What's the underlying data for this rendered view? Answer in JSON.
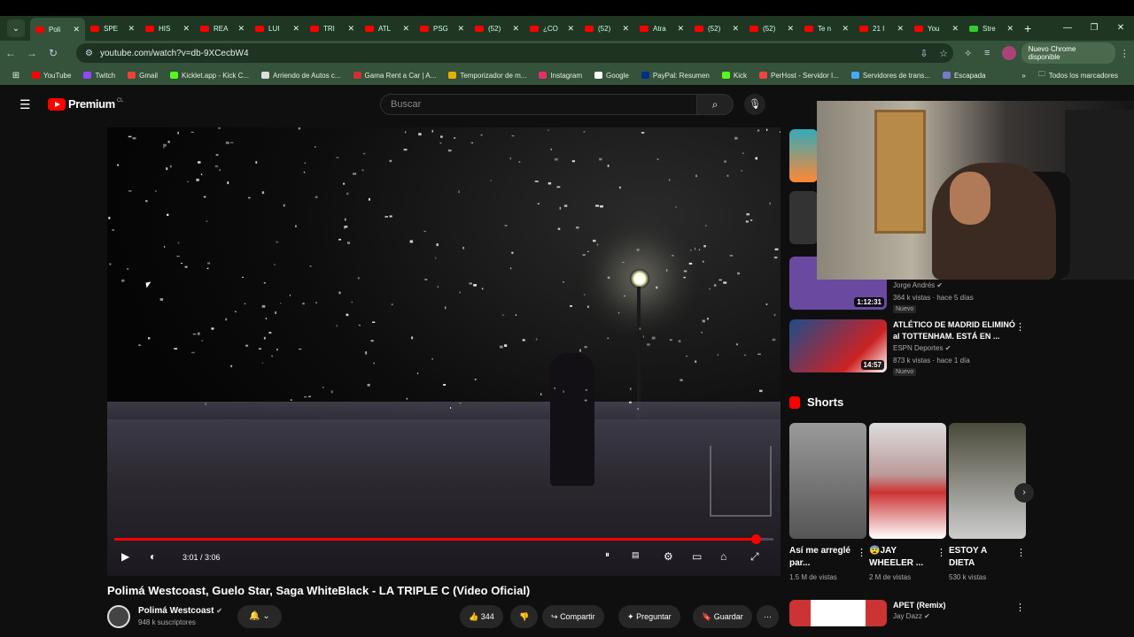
{
  "browser": {
    "tabs": [
      {
        "label": "Poli",
        "active": true
      },
      {
        "label": "SPE"
      },
      {
        "label": "HIS"
      },
      {
        "label": "REA"
      },
      {
        "label": "LUI"
      },
      {
        "label": "TRI"
      },
      {
        "label": "ATL"
      },
      {
        "label": "PSG"
      },
      {
        "label": "(52)"
      },
      {
        "label": "¿CO"
      },
      {
        "label": "(52)"
      },
      {
        "label": "Atra"
      },
      {
        "label": "(52)"
      },
      {
        "label": "(52)"
      },
      {
        "label": "Te n"
      },
      {
        "label": "21 I"
      },
      {
        "label": "You"
      },
      {
        "label": "Stre",
        "green": true
      }
    ],
    "url": "youtube.com/watch?v=db-9XCecbW4",
    "update_label": "Nuevo Chrome disponible",
    "bookmarks": [
      {
        "label": "YouTube",
        "color": "#ff0000"
      },
      {
        "label": "Twitch",
        "color": "#9146ff"
      },
      {
        "label": "Gmail",
        "color": "#ea4335"
      },
      {
        "label": "Kicklet.app - Kick C...",
        "color": "#53fc18"
      },
      {
        "label": "Arriendo de Autos c...",
        "color": "#dddddd"
      },
      {
        "label": "Gama Rent a Car | A...",
        "color": "#cc3333"
      },
      {
        "label": "Temporizador de m...",
        "color": "#e5b000"
      },
      {
        "label": "Instagram",
        "color": "#e1306c"
      },
      {
        "label": "Google",
        "color": "#ffffff"
      },
      {
        "label": "PayPal: Resumen",
        "color": "#003087"
      },
      {
        "label": "Kick",
        "color": "#53fc18"
      },
      {
        "label": "PerHost - Servidor I...",
        "color": "#e44"
      },
      {
        "label": "Servidores de trans...",
        "color": "#4af"
      },
      {
        "label": "Escapada",
        "color": "#77c"
      }
    ],
    "all_bookmarks": "Todos los marcadores"
  },
  "youtube": {
    "brand": "Premium",
    "region": "CL",
    "search_placeholder": "Buscar",
    "video": {
      "title": "Polimá Westcoast, Guelo Star, Saga WhiteBlack - LA TRIPLE C (Video Oficial)",
      "time": "3:01 / 3:06",
      "progress": 0.973,
      "channel": "Polimá Westcoast",
      "subs": "948 k suscriptores",
      "likes": "344",
      "share": "Compartir",
      "ask": "Preguntar",
      "save": "Guardar"
    },
    "related": [
      {
        "title": "",
        "channel": "Jorge Andrés",
        "meta": "364 k vistas · hace 5 días",
        "duration": "1:12:31",
        "badge": "Nuevo",
        "color": "#6a4aa0"
      },
      {
        "title": "ATLÉTICO DE MADRID ELIMINÓ al TOTTENHAM. ESTÁ EN ...",
        "channel": "ESPN Deportes",
        "meta": "873 k vistas · hace 1 día",
        "duration": "14:57",
        "badge": "Nuevo",
        "color": "#1d4d8a"
      }
    ],
    "shorts_label": "Shorts",
    "shorts": [
      {
        "title": "Así me arreglé par...",
        "views": "1.5 M de vistas",
        "color": "#8a8a8a"
      },
      {
        "title": "😨JAY WHEELER ...",
        "views": "2 M de vistas",
        "color": "#c43030"
      },
      {
        "title": "ESTOY A DIETA",
        "views": "530 k vistas",
        "color": "#6a6a5a"
      }
    ],
    "bottom": {
      "title": "APET (Remix)",
      "channel": "Jay Dazz"
    }
  }
}
